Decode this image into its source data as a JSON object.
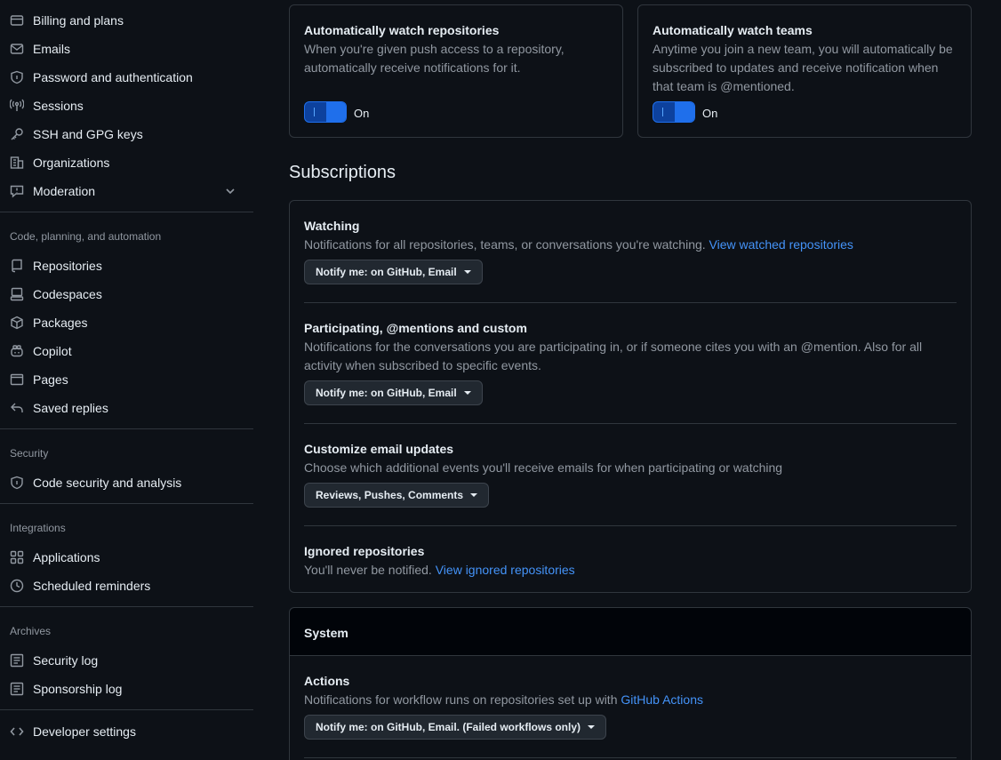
{
  "sidebar": {
    "items_top": [
      {
        "label": "Billing and plans",
        "icon": "credit-card-icon"
      },
      {
        "label": "Emails",
        "icon": "mail-icon"
      },
      {
        "label": "Password and authentication",
        "icon": "shield-lock-icon"
      },
      {
        "label": "Sessions",
        "icon": "broadcast-icon"
      },
      {
        "label": "SSH and GPG keys",
        "icon": "key-icon"
      },
      {
        "label": "Organizations",
        "icon": "organization-icon"
      },
      {
        "label": "Moderation",
        "icon": "report-icon"
      }
    ],
    "group_code": {
      "heading": "Code, planning, and automation",
      "items": [
        {
          "label": "Repositories",
          "icon": "repo-icon"
        },
        {
          "label": "Codespaces",
          "icon": "codespaces-icon"
        },
        {
          "label": "Packages",
          "icon": "package-icon"
        },
        {
          "label": "Copilot",
          "icon": "copilot-icon"
        },
        {
          "label": "Pages",
          "icon": "browser-icon"
        },
        {
          "label": "Saved replies",
          "icon": "reply-icon"
        }
      ]
    },
    "group_security": {
      "heading": "Security",
      "items": [
        {
          "label": "Code security and analysis",
          "icon": "shield-lock-icon"
        }
      ]
    },
    "group_integrations": {
      "heading": "Integrations",
      "items": [
        {
          "label": "Applications",
          "icon": "apps-icon"
        },
        {
          "label": "Scheduled reminders",
          "icon": "clock-icon"
        }
      ]
    },
    "group_archives": {
      "heading": "Archives",
      "items": [
        {
          "label": "Security log",
          "icon": "log-icon"
        },
        {
          "label": "Sponsorship log",
          "icon": "log-icon"
        }
      ]
    },
    "developer": {
      "label": "Developer settings",
      "icon": "code-icon"
    }
  },
  "watch_repos": {
    "title": "Automatically watch repositories",
    "desc_line1": "When you're given push access to a repository,",
    "desc_line2": "automatically receive notifications for it.",
    "toggle_label": "On"
  },
  "watch_teams": {
    "title": "Automatically watch teams",
    "desc_line1": "Anytime you join a new team, you will automatically be",
    "desc_line2": "subscribed to updates and receive notification when",
    "desc_line3": "that team is @mentioned.",
    "toggle_label": "On"
  },
  "subscriptions": {
    "title": "Subscriptions",
    "watching": {
      "title": "Watching",
      "desc": "Notifications for all repositories, teams, or conversations you're watching.",
      "link": "View watched repositories",
      "dropdown": "Notify me: on GitHub, Email"
    },
    "participating": {
      "title": "Participating, @mentions and custom",
      "desc_line1": "Notifications for the conversations you are participating in, or if someone cites you with an @mention. Also for all",
      "desc_line2": "activity when subscribed to specific events.",
      "dropdown": "Notify me: on GitHub, Email"
    },
    "email_updates": {
      "title": "Customize email updates",
      "desc": "Choose which additional events you'll receive emails for when participating or watching",
      "dropdown": "Reviews, Pushes, Comments"
    },
    "ignored": {
      "title": "Ignored repositories",
      "desc": "You'll never be notified.",
      "link": "View ignored repositories"
    }
  },
  "system": {
    "title": "System",
    "actions": {
      "title": "Actions",
      "desc": "Notifications for workflow runs on repositories set up with",
      "link": "GitHub Actions",
      "dropdown": "Notify me: on GitHub, Email. (Failed workflows only)"
    }
  }
}
